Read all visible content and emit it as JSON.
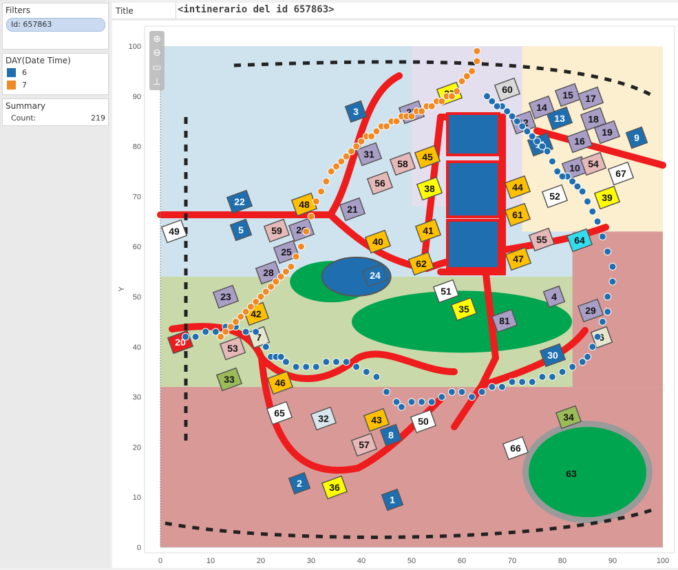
{
  "filters": {
    "title": "Filters",
    "chip": "Id: 657863"
  },
  "legend": {
    "title": "DAY(Date Time)",
    "items": [
      {
        "label": "6",
        "color": "#1f6fb0"
      },
      {
        "label": "7",
        "color": "#f08a24"
      }
    ]
  },
  "summary": {
    "title": "Summary",
    "label": "Count:",
    "value": "219"
  },
  "header": {
    "title_label": "Title",
    "title_text": "<intinerario del id 657863>"
  },
  "chart_data": {
    "type": "scatter",
    "title": "<intinerario del id 657863>",
    "xlabel": "",
    "ylabel": "Y",
    "xlim": [
      0,
      100
    ],
    "ylim": [
      0,
      100
    ],
    "xticks": [
      0,
      10,
      20,
      30,
      40,
      50,
      60,
      70,
      80,
      90,
      100
    ],
    "yticks": [
      0,
      10,
      20,
      30,
      40,
      50,
      60,
      70,
      80,
      90,
      100
    ],
    "series": [
      {
        "name": "6",
        "color": "#1f6fb0",
        "x": [
          5,
          7,
          9,
          11,
          13,
          15,
          17,
          19,
          21,
          22,
          23,
          24,
          25,
          27,
          29,
          31,
          33,
          35,
          37,
          39,
          41,
          43,
          45,
          47,
          48,
          50,
          52,
          54,
          56,
          58,
          60,
          62,
          64,
          66,
          68,
          70,
          72,
          74,
          76,
          78,
          80,
          82,
          84,
          85,
          86,
          87,
          88,
          89,
          89,
          90,
          90,
          89,
          88,
          87,
          86,
          85,
          84,
          83,
          82,
          81,
          80,
          79,
          78,
          77,
          76,
          75,
          74,
          73,
          72,
          71,
          70,
          69,
          68,
          67,
          66,
          65
        ],
        "y": [
          42,
          42,
          43,
          43,
          44,
          44,
          43,
          43,
          40,
          38,
          38,
          38,
          37,
          36,
          36,
          36,
          37,
          37,
          37,
          36,
          35,
          34,
          31,
          29,
          28,
          29,
          29,
          29,
          30,
          31,
          31,
          30,
          31,
          32,
          32,
          33,
          33,
          33,
          34,
          34,
          35,
          36,
          37,
          38,
          40,
          42,
          45,
          47,
          50,
          53,
          56,
          59,
          62,
          65,
          67,
          69,
          71,
          72,
          73,
          74,
          74,
          75,
          77,
          79,
          80,
          81,
          82,
          83,
          84,
          85,
          86,
          87,
          88,
          88,
          89,
          90
        ]
      },
      {
        "name": "7",
        "color": "#f08a24",
        "x": [
          12,
          13,
          14,
          15,
          16,
          17,
          18,
          19,
          20,
          21,
          22,
          23,
          24,
          25,
          26,
          27,
          28,
          29,
          30,
          31,
          32,
          33,
          34,
          35,
          36,
          37,
          38,
          39,
          40,
          41,
          42,
          43,
          44,
          45,
          46,
          47,
          48,
          49,
          50,
          51,
          52,
          53,
          54,
          55,
          56,
          57,
          58,
          59,
          60,
          61,
          62,
          63,
          63
        ],
        "y": [
          42,
          43,
          44,
          45,
          46,
          47,
          48,
          49,
          50,
          51,
          52,
          53,
          54,
          55,
          56,
          58,
          60,
          63,
          66,
          69,
          71,
          73,
          75,
          76,
          77,
          78,
          79,
          80,
          81,
          82,
          82,
          83,
          84,
          84,
          85,
          85,
          86,
          86,
          86,
          87,
          87,
          88,
          88,
          89,
          89,
          90,
          90,
          91,
          93,
          94,
          95,
          97,
          99
        ]
      }
    ],
    "map_labels": [
      "1",
      "2",
      "3",
      "4",
      "5",
      "6",
      "7",
      "8",
      "9",
      "10",
      "11",
      "12",
      "13",
      "14",
      "15",
      "16",
      "17",
      "18",
      "19",
      "20",
      "21",
      "22",
      "23",
      "24",
      "25",
      "26",
      "27",
      "28",
      "29",
      "30",
      "31",
      "32",
      "33",
      "34",
      "35",
      "36",
      "37",
      "38",
      "39",
      "40",
      "41",
      "42",
      "43",
      "44",
      "45",
      "46",
      "47",
      "48",
      "49",
      "50",
      "51",
      "52",
      "53",
      "54",
      "55",
      "56",
      "57",
      "58",
      "59",
      "60",
      "61",
      "62",
      "63",
      "64",
      "65",
      "66",
      "67",
      "81"
    ]
  }
}
